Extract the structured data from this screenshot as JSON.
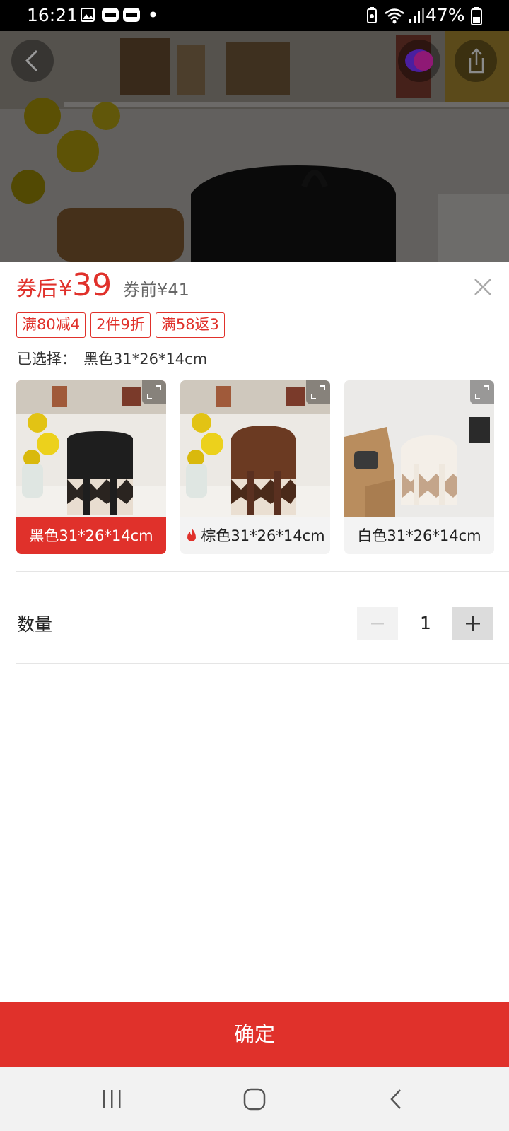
{
  "status_bar": {
    "time": "16:21",
    "notification_icons": [
      "gallery-icon",
      "zalo-icon",
      "zalo-icon",
      "dot-icon"
    ],
    "system_icons": [
      "battery-saver-icon",
      "wifi-icon",
      "signal-icon"
    ],
    "battery": "47%"
  },
  "hero": {
    "back_icon": "chevron-left-icon",
    "favorite_icon": "heart-icon",
    "share_icon": "share-icon"
  },
  "price": {
    "label": "券后",
    "currency": "¥",
    "value": "39",
    "original": "券前¥41"
  },
  "promo_tags": [
    "满80减4",
    "2件9折",
    "满58返3"
  ],
  "selection": {
    "label": "已选择：",
    "value": "黑色31*26*14cm"
  },
  "options": [
    {
      "label": "黑色31*26*14cm",
      "selected": true,
      "hot": false
    },
    {
      "label": "棕色31*26*14cm",
      "selected": false,
      "hot": true
    },
    {
      "label": "白色31*26*14cm",
      "selected": false,
      "hot": false
    }
  ],
  "quantity": {
    "label": "数量",
    "value": "1",
    "minus_icon": "minus-icon",
    "plus_icon": "plus-icon"
  },
  "confirm_label": "确定",
  "nav": [
    "recent-apps-icon",
    "home-icon",
    "back-icon"
  ],
  "colors": {
    "accent": "#e0312b",
    "status_bar": "#000000",
    "nav_bar": "#f2f2f2"
  }
}
